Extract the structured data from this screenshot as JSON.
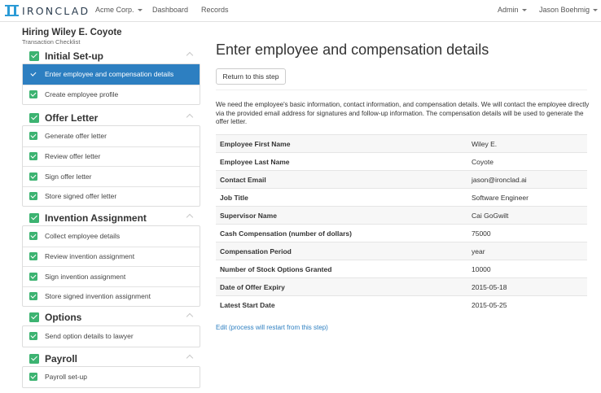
{
  "navbar": {
    "brand": "IRONCLAD",
    "org_menu": "Acme Corp.",
    "dashboard": "Dashboard",
    "records": "Records",
    "admin_menu": "Admin",
    "user_menu": "Jason Boehmig"
  },
  "sidebar": {
    "title": "Hiring Wiley E. Coyote",
    "subtitle": "Transaction Checklist",
    "sections": [
      {
        "label": "Initial Set-up",
        "items": [
          "Enter employee and compensation details",
          "Create employee profile"
        ]
      },
      {
        "label": "Offer Letter",
        "items": [
          "Generate offer letter",
          "Review offer letter",
          "Sign offer letter",
          "Store signed offer letter"
        ]
      },
      {
        "label": "Invention Assignment",
        "items": [
          "Collect employee details",
          "Review invention assignment",
          "Sign invention assignment",
          "Store signed invention assignment"
        ]
      },
      {
        "label": "Options",
        "items": [
          "Send option details to lawyer"
        ]
      },
      {
        "label": "Payroll",
        "items": [
          "Payroll set-up"
        ]
      }
    ],
    "active_item": "Enter employee and compensation details"
  },
  "main": {
    "title": "Enter employee and compensation details",
    "return_button": "Return to this step",
    "description": "We need the employee's basic information, contact information, and compensation details. We will contact the employee directly via the provided email address for signatures and follow-up information. The compensation details will be used to generate the offer letter.",
    "rows": [
      {
        "label": "Employee First Name",
        "value": "Wiley E."
      },
      {
        "label": "Employee Last Name",
        "value": "Coyote"
      },
      {
        "label": "Contact Email",
        "value": "jason@ironclad.ai"
      },
      {
        "label": "Job Title",
        "value": "Software Engineer"
      },
      {
        "label": "Supervisor Name",
        "value": "Cai GoGwilt"
      },
      {
        "label": "Cash Compensation (number of dollars)",
        "value": "75000"
      },
      {
        "label": "Compensation Period",
        "value": "year"
      },
      {
        "label": "Number of Stock Options Granted",
        "value": "10000"
      },
      {
        "label": "Date of Offer Expiry",
        "value": "2015-05-18"
      },
      {
        "label": "Latest Start Date",
        "value": "2015-05-25"
      }
    ],
    "edit_link": "Edit (process will restart from this step)"
  },
  "colors": {
    "brand": "#2b9bd6",
    "active_item": "#2d7fc1",
    "check_green": "#3cb371",
    "link": "#2d7fc1"
  }
}
